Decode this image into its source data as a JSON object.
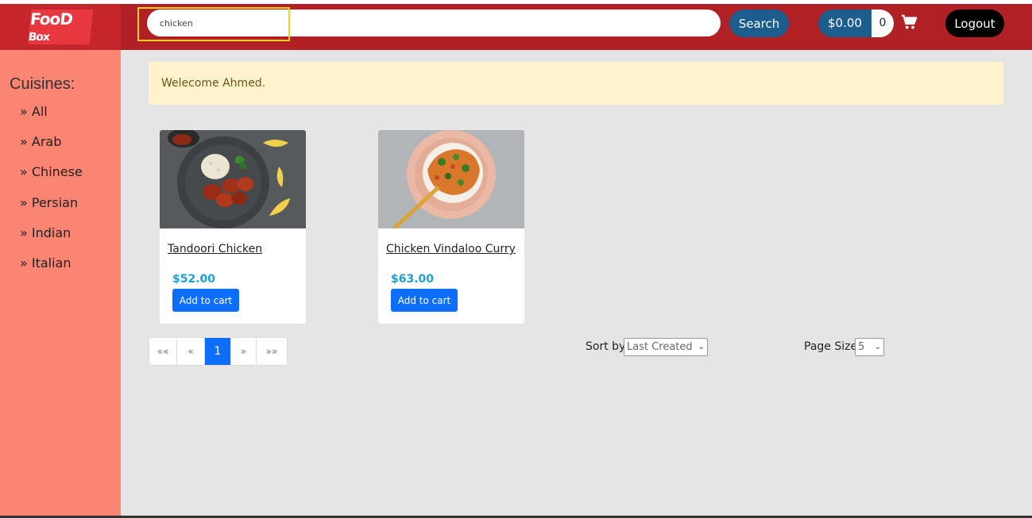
{
  "brand": {
    "logo_text_a": "FooD",
    "logo_text_b": "Box"
  },
  "header": {
    "search": {
      "value": "chicken",
      "placeholder": ""
    },
    "search_label": "Search",
    "cart_total": "$0.00",
    "cart_count": "0",
    "logout_label": "Logout"
  },
  "sidebar": {
    "title": "Cuisines:",
    "items": [
      {
        "label": "» All"
      },
      {
        "label": "» Arab"
      },
      {
        "label": "» Chinese"
      },
      {
        "label": "» Persian"
      },
      {
        "label": "» Indian"
      },
      {
        "label": "» Italian"
      }
    ]
  },
  "welcome": {
    "message": "Welecome Ahmed."
  },
  "products": [
    {
      "name": "Tandoori Chicken",
      "price": "$52.00",
      "button": "Add to cart"
    },
    {
      "name": "Chicken Vindaloo Curry",
      "price": "$63.00",
      "button": "Add to cart"
    }
  ],
  "pagination": {
    "first": "««",
    "prev": "«",
    "current": "1",
    "next": "»",
    "last": "»»"
  },
  "sort": {
    "label": "Sort by",
    "selected": "Last Created"
  },
  "page_size": {
    "label": "Page Size",
    "selected": "5"
  },
  "colors": {
    "header": "#b02024",
    "sidebar": "#fa8572",
    "accent": "#0d6efd",
    "price": "#1aa0d3",
    "pill": "#1d5d8e"
  },
  "icons": {
    "cart": "cart-icon",
    "dropdown": "chevron-down-icon"
  }
}
